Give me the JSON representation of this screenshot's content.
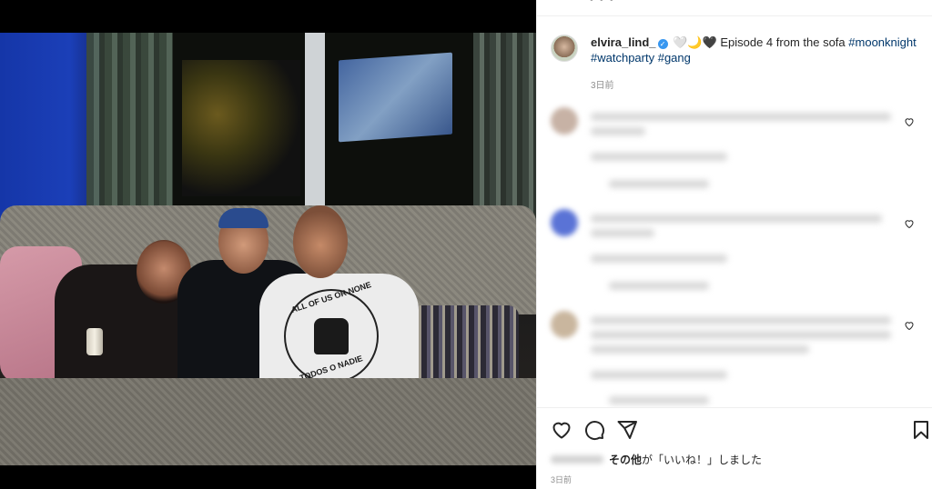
{
  "post": {
    "username": "elvira_lind_",
    "caption_text": "🤍🌙🖤 Episode 4 from the sofa",
    "hashtags": [
      "#moonknight",
      "#watchparty",
      "#gang"
    ],
    "timestamp": "3日前"
  },
  "photo": {
    "shirt_top": "ALL OF US OR NONE",
    "shirt_bottom": "TODOS O NADIE"
  },
  "likes": {
    "suffix": "その他が「いいね！」しました",
    "others_label": "その他"
  },
  "footer": {
    "timestamp": "3日前"
  },
  "icons": {
    "like": "heart-icon",
    "comment": "comment-icon",
    "share": "share-icon",
    "save": "bookmark-icon"
  },
  "colors": {
    "hashtag": "#00376b",
    "verified": "#3897f0",
    "muted": "#8e8e8e",
    "text": "#262626"
  }
}
